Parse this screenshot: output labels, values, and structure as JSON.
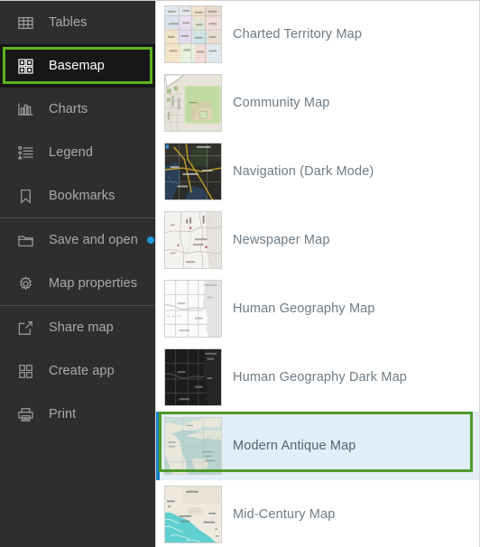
{
  "sidebar": {
    "groups": [
      {
        "items": [
          {
            "label": "Tables",
            "icon": "table-icon",
            "selected": false,
            "dot": false
          },
          {
            "label": "Basemap",
            "icon": "basemap-grid-icon",
            "selected": true,
            "dot": false
          },
          {
            "label": "Charts",
            "icon": "chart-bars-icon",
            "selected": false,
            "dot": false
          },
          {
            "label": "Legend",
            "icon": "legend-list-icon",
            "selected": false,
            "dot": false
          },
          {
            "label": "Bookmarks",
            "icon": "bookmark-icon",
            "selected": false,
            "dot": false
          }
        ]
      },
      {
        "items": [
          {
            "label": "Save and open",
            "icon": "folder-icon",
            "selected": false,
            "dot": true
          },
          {
            "label": "Map properties",
            "icon": "gear-icon",
            "selected": false,
            "dot": false
          }
        ]
      },
      {
        "items": [
          {
            "label": "Share map",
            "icon": "share-icon",
            "selected": false,
            "dot": false
          },
          {
            "label": "Create app",
            "icon": "grid-apps-icon",
            "selected": false,
            "dot": false
          },
          {
            "label": "Print",
            "icon": "printer-icon",
            "selected": false,
            "dot": false
          }
        ]
      }
    ]
  },
  "basemaps": {
    "items": [
      {
        "label": "Charted Territory Map",
        "thumb": "charted-territory",
        "selected": false
      },
      {
        "label": "Community Map",
        "thumb": "community",
        "selected": false
      },
      {
        "label": "Navigation (Dark Mode)",
        "thumb": "navigation-dark",
        "selected": false
      },
      {
        "label": "Newspaper Map",
        "thumb": "newspaper",
        "selected": false
      },
      {
        "label": "Human Geography Map",
        "thumb": "human-geography",
        "selected": false
      },
      {
        "label": "Human Geography Dark Map",
        "thumb": "human-geography-dark",
        "selected": false
      },
      {
        "label": "Modern Antique Map",
        "thumb": "modern-antique",
        "selected": true
      },
      {
        "label": "Mid-Century Map",
        "thumb": "mid-century",
        "selected": false
      }
    ]
  },
  "highlights": {
    "nav_highlight_target": "Basemap",
    "nav_highlight_color": "#5eb320",
    "card_highlight_target": "Modern Antique Map",
    "card_highlight_color": "#4e9a2a",
    "active_card_accent": "#1b81c4",
    "notification_dot_color": "#1f9bdd"
  }
}
